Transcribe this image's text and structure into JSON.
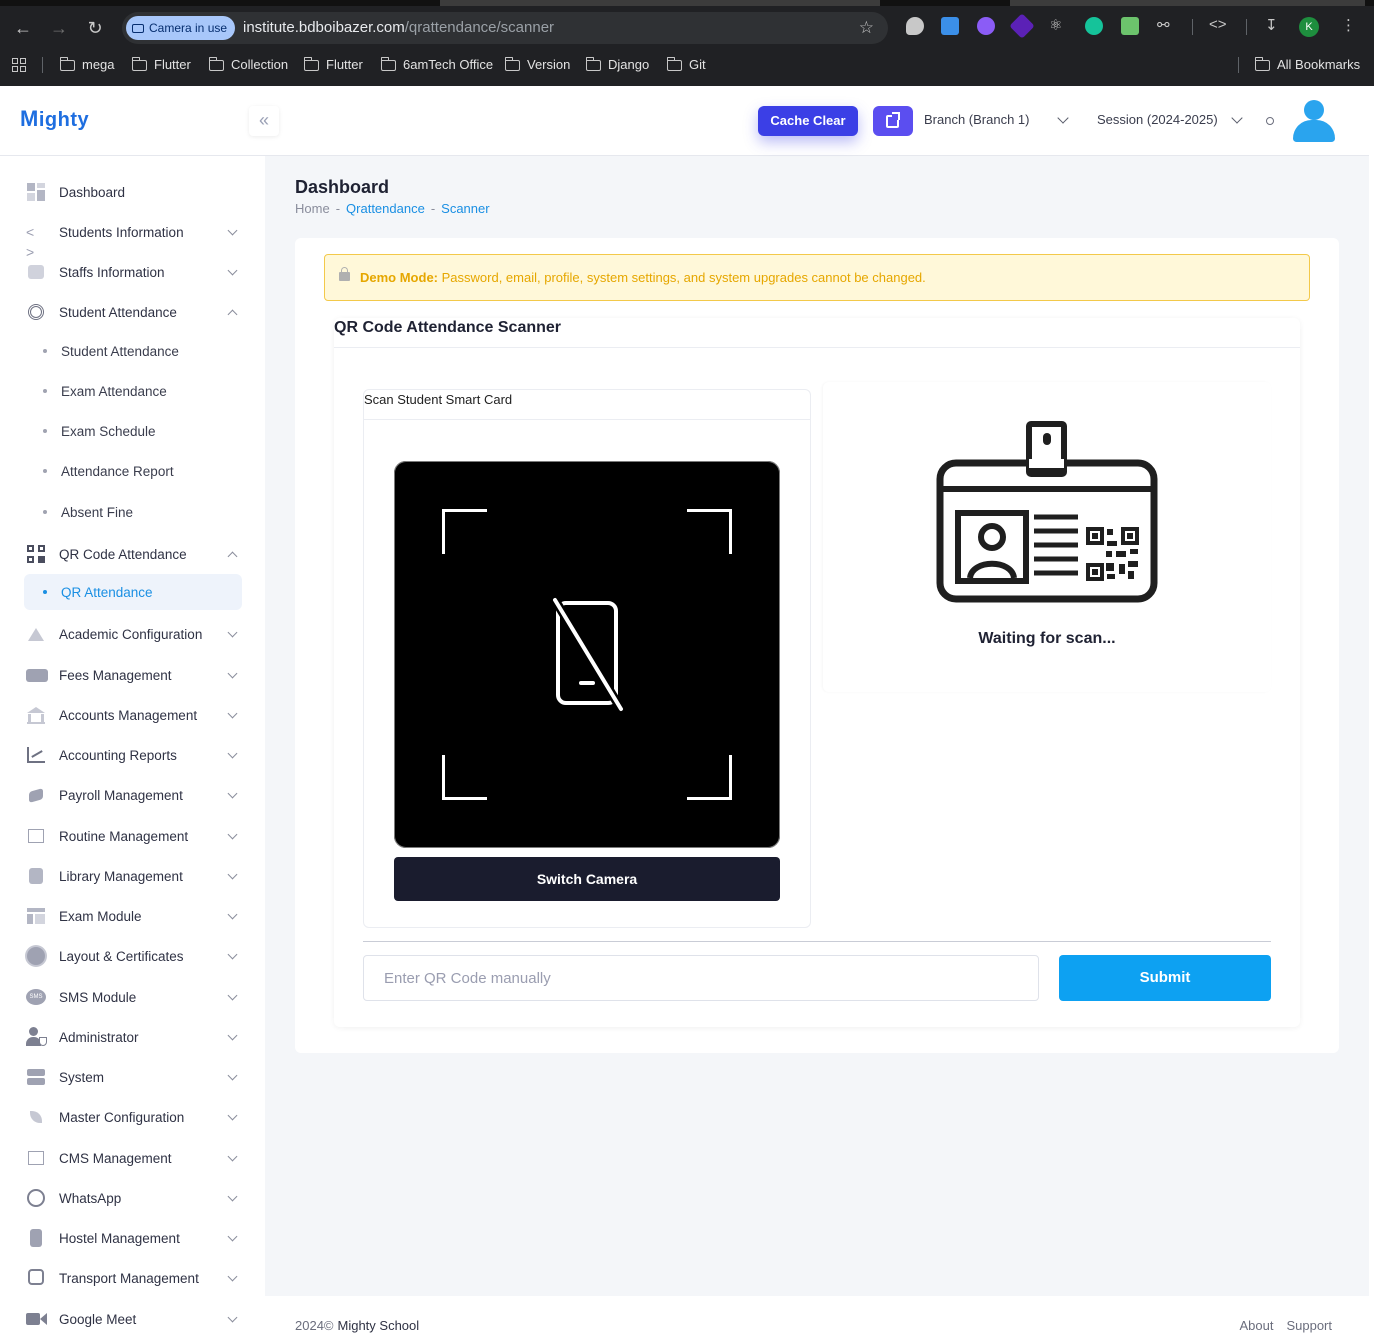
{
  "browser": {
    "camera_badge": "Camera in use",
    "url_host": "institute.bdboibazer.com",
    "url_path": "/qrattendance/scanner",
    "profile_initial": "K",
    "bookmarks": [
      "mega",
      "Flutter",
      "Collection",
      "Flutter",
      "6amTech Office",
      "Version",
      "Django",
      "Git"
    ],
    "all_bookmarks": "All Bookmarks"
  },
  "header": {
    "logo_text": "ighty",
    "logo_initial": "M",
    "cache_clear": "Cache Clear",
    "branch": "Branch (Branch 1)",
    "session": "Session (2024-2025)"
  },
  "sidebar": {
    "items": [
      {
        "label": "Dashboard",
        "icon": "dashboard-icon"
      },
      {
        "label": "Students Information",
        "icon": "code-icon"
      },
      {
        "label": "Staffs Information",
        "icon": "id-card-icon"
      },
      {
        "label": "Student Attendance",
        "icon": "fingerprint-icon"
      },
      {
        "label": "QR Code Attendance",
        "icon": "qr-code-icon"
      },
      {
        "label": "Academic Configuration",
        "icon": "drive-icon"
      },
      {
        "label": "Fees Management",
        "icon": "money-icon"
      },
      {
        "label": "Accounts Management",
        "icon": "bank-icon"
      },
      {
        "label": "Accounting Reports",
        "icon": "chart-line-icon"
      },
      {
        "label": "Payroll Management",
        "icon": "payroll-icon"
      },
      {
        "label": "Routine Management",
        "icon": "map-icon"
      },
      {
        "label": "Library Management",
        "icon": "book-icon"
      },
      {
        "label": "Exam Module",
        "icon": "layout-icon"
      },
      {
        "label": "Layout & Certificates",
        "icon": "gear-badge-icon"
      },
      {
        "label": "SMS Module",
        "icon": "sms-icon"
      },
      {
        "label": "Administrator",
        "icon": "admin-icon"
      },
      {
        "label": "System",
        "icon": "server-icon"
      },
      {
        "label": "Master Configuration",
        "icon": "rocket-icon"
      },
      {
        "label": "CMS Management",
        "icon": "map-icon"
      },
      {
        "label": "WhatsApp",
        "icon": "whatsapp-icon"
      },
      {
        "label": "Hostel Management",
        "icon": "building-icon"
      },
      {
        "label": "Transport Management",
        "icon": "bus-icon"
      },
      {
        "label": "Google Meet",
        "icon": "video-icon"
      }
    ],
    "attendance_sub": [
      "Student Attendance",
      "Exam Attendance",
      "Exam Schedule",
      "Attendance Report",
      "Absent Fine"
    ],
    "qr_sub": [
      "QR Attendance"
    ]
  },
  "page": {
    "title": "Dashboard",
    "breadcrumb": [
      "Home",
      "Qrattendance",
      "Scanner"
    ],
    "breadcrumb_sep": "-",
    "demo_label": "Demo Mode:",
    "demo_text": "Password, email, profile, system settings, and system upgrades cannot be changed.",
    "scanner_title": "QR Code Attendance Scanner",
    "scan_card_title": "Scan Student Smart Card",
    "switch_camera": "Switch Camera",
    "waiting": "Waiting for scan...",
    "manual_placeholder": "Enter QR Code manually",
    "manual_value": "",
    "submit": "Submit"
  },
  "footer": {
    "year": "2024©",
    "brand": "Mighty School",
    "about": "About",
    "support": "Support"
  },
  "colors": {
    "primary": "#3b3fe6",
    "accent": "#0da1f2",
    "active_link": "#1a8fe3",
    "warning": "#e6a700"
  }
}
